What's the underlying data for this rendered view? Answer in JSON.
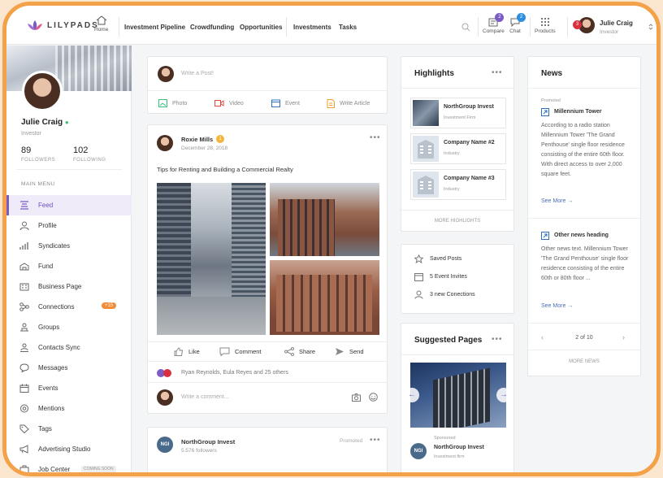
{
  "brand": {
    "logo_text": "LILYPADS",
    "accent": "#7a5cc4",
    "frame_color": "#f4a24a"
  },
  "nav": {
    "home": "Home",
    "links": [
      "Investment Pipeline",
      "Crowdfunding",
      "Opportunities",
      "Investments",
      "Tasks"
    ]
  },
  "toolbar": {
    "compare_label": "Compare",
    "compare_badge": "2",
    "chat_label": "Chat",
    "chat_badge": "2",
    "products_label": "Products",
    "notif_badge": "3",
    "user_name": "Julie Craig",
    "user_role": "Investor"
  },
  "profile": {
    "name": "Julie Craig",
    "role": "Investor",
    "followers_count": "89",
    "followers_label": "FOLLOWERS",
    "following_count": "102",
    "following_label": "FOLLOWING",
    "menu_title": "MAIN MENU"
  },
  "menu": [
    {
      "label": "Feed",
      "icon": "feed-icon"
    },
    {
      "label": "Profile",
      "icon": "user-icon"
    },
    {
      "label": "Syndicates",
      "icon": "bar-chart-icon"
    },
    {
      "label": "Fund",
      "icon": "fund-icon"
    },
    {
      "label": "Business Page",
      "icon": "business-icon"
    },
    {
      "label": "Connections",
      "icon": "connections-icon",
      "badge": "+15"
    },
    {
      "label": "Groups",
      "icon": "groups-icon"
    },
    {
      "label": "Contacts Sync",
      "icon": "contacts-sync-icon"
    },
    {
      "label": "Messages",
      "icon": "chat-bubble-icon"
    },
    {
      "label": "Events",
      "icon": "calendar-icon"
    },
    {
      "label": "Mentions",
      "icon": "at-icon"
    },
    {
      "label": "Tags",
      "icon": "tag-icon"
    },
    {
      "label": "Advertising Studio",
      "icon": "megaphone-icon"
    },
    {
      "label": "Job Center",
      "icon": "briefcase-icon",
      "badge": "COMING SOON"
    }
  ],
  "composer": {
    "placeholder": "Write a Post!",
    "photo": "Photo",
    "video": "Video",
    "event": "Event",
    "article": "Write Article"
  },
  "post": {
    "author": "Roxie Mills",
    "author_badge": "1",
    "date": "December 28, 2018",
    "text": "Tips for Renting and Building a Commercial Realty",
    "like": "Like",
    "comment": "Comment",
    "share": "Share",
    "send": "Send",
    "reactions": "Ryan Reynolds, Eula Reyes and 25 others",
    "comment_placeholder": "Write a comment..."
  },
  "post2": {
    "author": "NorthGroup Invest",
    "followers": "5.576 followers",
    "promoted": "Promoted"
  },
  "highlights": {
    "title": "Highlights",
    "items": [
      {
        "name": "NorthGroup Invest",
        "sub": "Investment Firm"
      },
      {
        "name": "Company Name #2",
        "sub": "Industry"
      },
      {
        "name": "Company Name #3",
        "sub": "Industry"
      }
    ],
    "more": "MORE HIGHLIGHTS"
  },
  "quick": {
    "items": [
      "Saved Posts",
      "5 Event Invites",
      "3 new Conections"
    ]
  },
  "suggested": {
    "title": "Suggested Pages",
    "sponsored": "Sponsored",
    "name": "NorthGroup Invest",
    "sub": "Investment firm"
  },
  "news": {
    "title": "News",
    "promoted": "Promoted",
    "item1_title": "Millennium Tower",
    "item1_text": "According to a radio station Millennium Tower 'The Grand Penthouse' single floor residence consisting of the entire 60th floor. With direct access to over 2,000 square feet.",
    "see_more": "See More",
    "item2_title": "Other news heading",
    "item2_text": "Other news text. Millennium Tower 'The Grand Penthouse' single floor residence consisting of the entire 60th or 80th floor ...",
    "pager": "2 of 10",
    "more": "MORE NEWS"
  }
}
